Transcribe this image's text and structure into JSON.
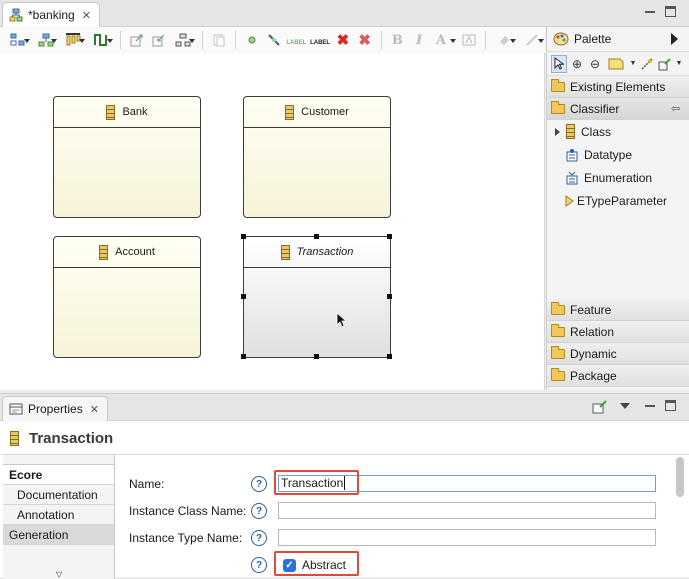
{
  "editor": {
    "tab_title": "*banking",
    "nodes": [
      {
        "name": "Bank",
        "italic": false
      },
      {
        "name": "Customer",
        "italic": false
      },
      {
        "name": "Account",
        "italic": false
      },
      {
        "name": "Transaction",
        "italic": true
      }
    ],
    "toolbar": {
      "label_icon_1": "LABEL",
      "label_icon_2": "LABEL",
      "bold": "B",
      "italic": "I",
      "font": "A"
    }
  },
  "palette": {
    "title": "Palette",
    "drawers": {
      "existing": "Existing Elements",
      "classifier": "Classifier",
      "feature": "Feature",
      "relation": "Relation",
      "dynamic": "Dynamic",
      "package": "Package"
    },
    "classifier_items": [
      "Class",
      "Datatype",
      "Enumeration",
      "ETypeParameter"
    ]
  },
  "properties": {
    "tab_title": "Properties",
    "selected_title": "Transaction",
    "sections": [
      "Ecore",
      "Documentation",
      "Annotation",
      "Generation"
    ],
    "fields": {
      "name_label": "Name:",
      "name_value": "Transaction",
      "instance_class_label": "Instance Class Name:",
      "instance_class_value": "",
      "instance_type_label": "Instance Type Name:",
      "instance_type_value": "",
      "abstract_label": "Abstract",
      "abstract_checked": true
    },
    "help_glyph": "?"
  },
  "colors": {
    "node_fill": "#fffff3",
    "selected_node_fill": "#e0e0e0",
    "highlight_box": "#e04a3d",
    "checkbox": "#2f6fdb"
  }
}
